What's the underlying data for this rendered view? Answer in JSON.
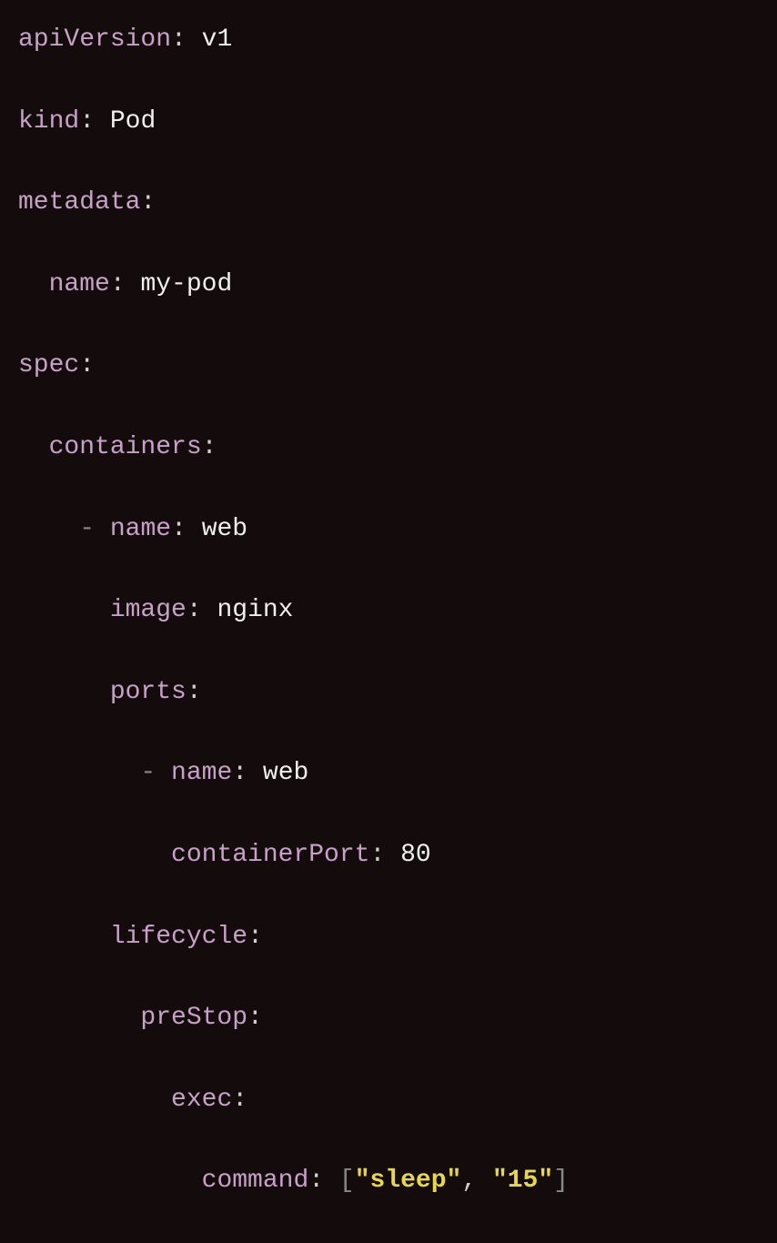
{
  "yaml": {
    "apiVersion_key": "apiVersion",
    "apiVersion_value": "v1",
    "kind_key": "kind",
    "kind_value": "Pod",
    "metadata_key": "metadata",
    "name_key": "name",
    "metadata_name_value": "my-pod",
    "spec_key": "spec",
    "containers_key": "containers",
    "container_name_key": "name",
    "container_name_value": "web",
    "image_key": "image",
    "image_value": "nginx",
    "ports_key": "ports",
    "port_name_key": "name",
    "port_name_value": "web",
    "containerPort_key": "containerPort",
    "containerPort_value": "80",
    "lifecycle_key": "lifecycle",
    "preStop_key": "preStop",
    "exec_key": "exec",
    "command_key": "command",
    "command_arg1": "\"sleep\"",
    "command_arg2": "\"15\""
  },
  "punct": {
    "colon": ":",
    "dash": "-",
    "lbracket": "[",
    "rbracket": "]",
    "comma": ","
  }
}
